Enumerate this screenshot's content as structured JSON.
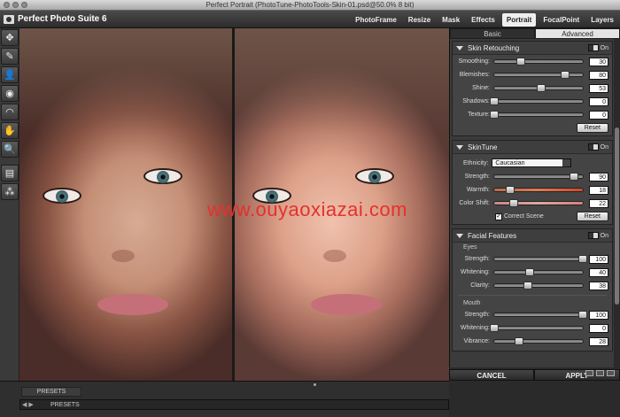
{
  "window_title": "Perfect Portrait (PhotoTune-PhotoTools-Skin-01.psd@50.0% 8 bit)",
  "app_title": "Perfect Photo Suite 6",
  "modules": [
    {
      "label": "PhotoFrame",
      "active": false
    },
    {
      "label": "Resize",
      "active": false
    },
    {
      "label": "Mask",
      "active": false
    },
    {
      "label": "Effects",
      "active": false
    },
    {
      "label": "Portrait",
      "active": true
    },
    {
      "label": "FocalPoint",
      "active": false
    },
    {
      "label": "Layers",
      "active": false
    }
  ],
  "tools": [
    "move-icon",
    "brush-icon",
    "portrait-icon",
    "eye-icon",
    "lips-icon",
    "hand-icon",
    "zoom-icon",
    "compare-icon",
    "group-icon"
  ],
  "watermark": "www.ouyaoxiazai.com",
  "panel": {
    "tabs": [
      {
        "label": "Basic",
        "active": false
      },
      {
        "label": "Advanced",
        "active": true
      }
    ],
    "skin_retouching": {
      "title": "Skin Retouching",
      "toggle": "On",
      "rows": [
        {
          "label": "Smoothing:",
          "value": "30",
          "level": 0.3
        },
        {
          "label": "Blemishes:",
          "value": "80",
          "level": 0.8
        },
        {
          "label": "Shine:",
          "value": "53",
          "level": 0.53
        },
        {
          "label": "Shadows:",
          "value": "0",
          "level": 0
        },
        {
          "label": "Texture:",
          "value": "0",
          "level": 0
        }
      ],
      "reset": "Reset"
    },
    "skintune": {
      "title": "SkinTune",
      "toggle": "On",
      "ethnicity_label": "Ethnicity:",
      "ethnicity_value": "Caucasian",
      "rows": [
        {
          "label": "Strength:",
          "value": "90",
          "level": 0.9,
          "style": ""
        },
        {
          "label": "Warmth:",
          "value": "18",
          "level": 0.18,
          "style": "warm"
        },
        {
          "label": "Color Shift:",
          "value": "22",
          "level": 0.22,
          "style": "shift"
        }
      ],
      "correct_scene": "Correct Scene",
      "reset": "Reset"
    },
    "facial_features": {
      "title": "Facial Features",
      "toggle": "On",
      "eyes_label": "Eyes",
      "eyes": [
        {
          "label": "Strength:",
          "value": "100",
          "level": 1.0
        },
        {
          "label": "Whitening:",
          "value": "40",
          "level": 0.4
        },
        {
          "label": "Clarity:",
          "value": "38",
          "level": 0.38
        }
      ],
      "mouth_label": "Mouth",
      "mouth": [
        {
          "label": "Strength:",
          "value": "100",
          "level": 1.0
        },
        {
          "label": "Whitening:",
          "value": "0",
          "level": 0
        },
        {
          "label": "Vibrance:",
          "value": "28",
          "level": 0.28
        }
      ]
    }
  },
  "bottom": {
    "presets_button": "PRESETS",
    "presets_label": "PRESETS",
    "cancel": "CANCEL",
    "apply": "APPLY"
  }
}
